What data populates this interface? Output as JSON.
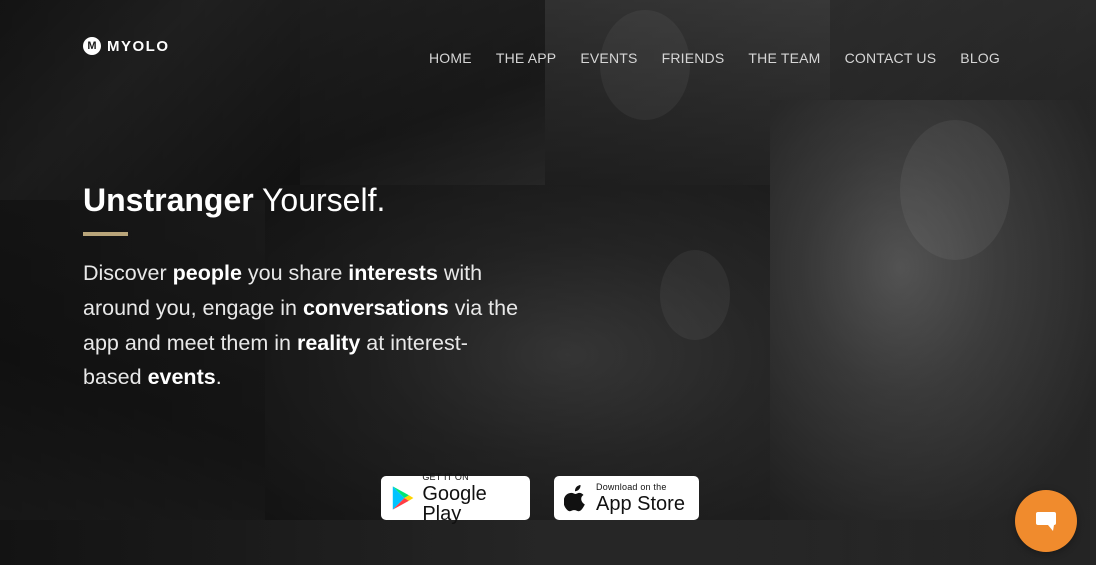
{
  "brand": {
    "logo_mark": "M",
    "name": "MYOLO"
  },
  "nav": {
    "items": [
      "HOME",
      "THE APP",
      "EVENTS",
      "FRIENDS",
      "THE TEAM",
      "CONTACT US",
      "BLOG"
    ]
  },
  "hero": {
    "title_bold": "Unstranger",
    "title_rest": "Yourself.",
    "accent_color": "#b9a57a",
    "text": {
      "p1": "Discover ",
      "b1": "people",
      "p2": " you share ",
      "b2": "interests",
      "p3": " with around you, engage in ",
      "b3": "conversations",
      "p4": " via the app and meet them in ",
      "b4": "reality",
      "p5": " at interest-based ",
      "b5": "events",
      "p6": "."
    }
  },
  "badges": {
    "google": {
      "small": "GET IT ON",
      "big": "Google Play",
      "icon": "google-play-icon"
    },
    "apple": {
      "small": "Download on the",
      "big": "App Store",
      "icon": "apple-icon"
    }
  },
  "chat": {
    "icon": "chat-bubble-icon",
    "color": "#f08b2d"
  }
}
